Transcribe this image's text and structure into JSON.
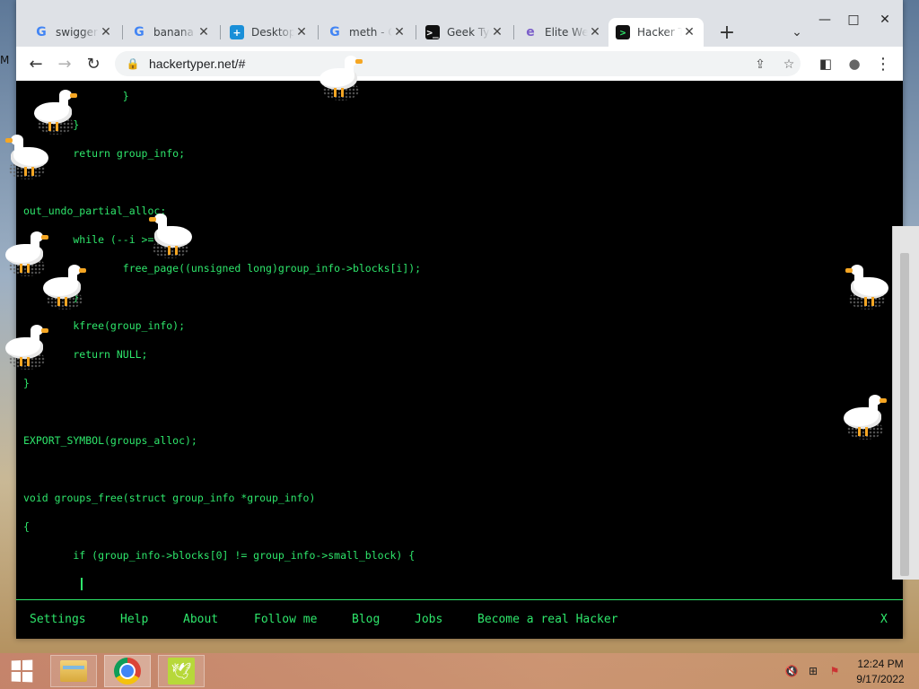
{
  "desktop": {
    "edge_letter": "M"
  },
  "browser": {
    "tabs": [
      {
        "title": "swiggers",
        "favicon": "G",
        "icon": "google-icon"
      },
      {
        "title": "banana",
        "favicon": "G",
        "icon": "google-icon"
      },
      {
        "title": "Desktop",
        "favicon": "+",
        "icon": "desktop-app-icon"
      },
      {
        "title": "meth - G",
        "favicon": "G",
        "icon": "google-icon"
      },
      {
        "title": "Geek Typ",
        "favicon": ">_",
        "icon": "terminal-icon"
      },
      {
        "title": "Elite We",
        "favicon": "e",
        "icon": "elite-icon"
      },
      {
        "title": "Hacker T",
        "favicon": ">",
        "icon": "hacker-terminal-icon",
        "active": true
      }
    ],
    "new_tab_glyph": "+",
    "tab_search_glyph": "⌄",
    "window_controls": {
      "minimize": "—",
      "maximize": "□",
      "close": "✕"
    },
    "toolbar": {
      "back_glyph": "←",
      "forward_glyph": "→",
      "reload_glyph": "↻",
      "lock_glyph": "🔒",
      "url": "hackertyper.net/#",
      "share_glyph": "⇪",
      "bookmark_glyph": "☆",
      "sidepanel_glyph": "◧",
      "profile_glyph": "●",
      "menu_glyph": "⋮"
    }
  },
  "page": {
    "code_lines": [
      {
        "text": "        }",
        "row": 0
      },
      {
        "text": "    }",
        "row": 1
      },
      {
        "text": "    return group_info;",
        "row": 2
      },
      {
        "text": "",
        "row": 3
      },
      {
        "text": "out_undo_partial_alloc:",
        "row": 4
      },
      {
        "text": "    while (--i >= 0) {",
        "row": 5
      },
      {
        "text": "        free_page((unsigned long)group_info->blocks[i]);",
        "row": 6
      },
      {
        "text": "    }",
        "row": 7
      },
      {
        "text": "    kfree(group_info);",
        "row": 8
      },
      {
        "text": "    return NULL;",
        "row": 9
      },
      {
        "text": "}",
        "row": 10
      },
      {
        "text": "",
        "row": 11
      },
      {
        "text": "EXPORT_SYMBOL(groups_alloc);",
        "row": 12
      },
      {
        "text": "",
        "row": 13
      },
      {
        "text": "void groups_free(struct group_info *group_info)",
        "row": 14
      },
      {
        "text": "{",
        "row": 15
      },
      {
        "text": "    if (group_info->blocks[0] != group_info->small_block) {",
        "row": 16
      }
    ],
    "footer": {
      "settings": "Settings",
      "help": "Help",
      "about": "About",
      "follow": "Follow me",
      "blog": "Blog",
      "jobs": "Jobs",
      "hacker": "Become a real Hacker",
      "close": "X"
    }
  },
  "taskbar": {
    "time": "12:24 PM",
    "date": "9/17/2022",
    "tray": {
      "volume": "🔇",
      "network": "⊞",
      "flag": "⚑"
    }
  },
  "colors": {
    "terminal_green": "#2ee66b",
    "page_bg": "#000000",
    "goose_beak": "#f5a623"
  }
}
